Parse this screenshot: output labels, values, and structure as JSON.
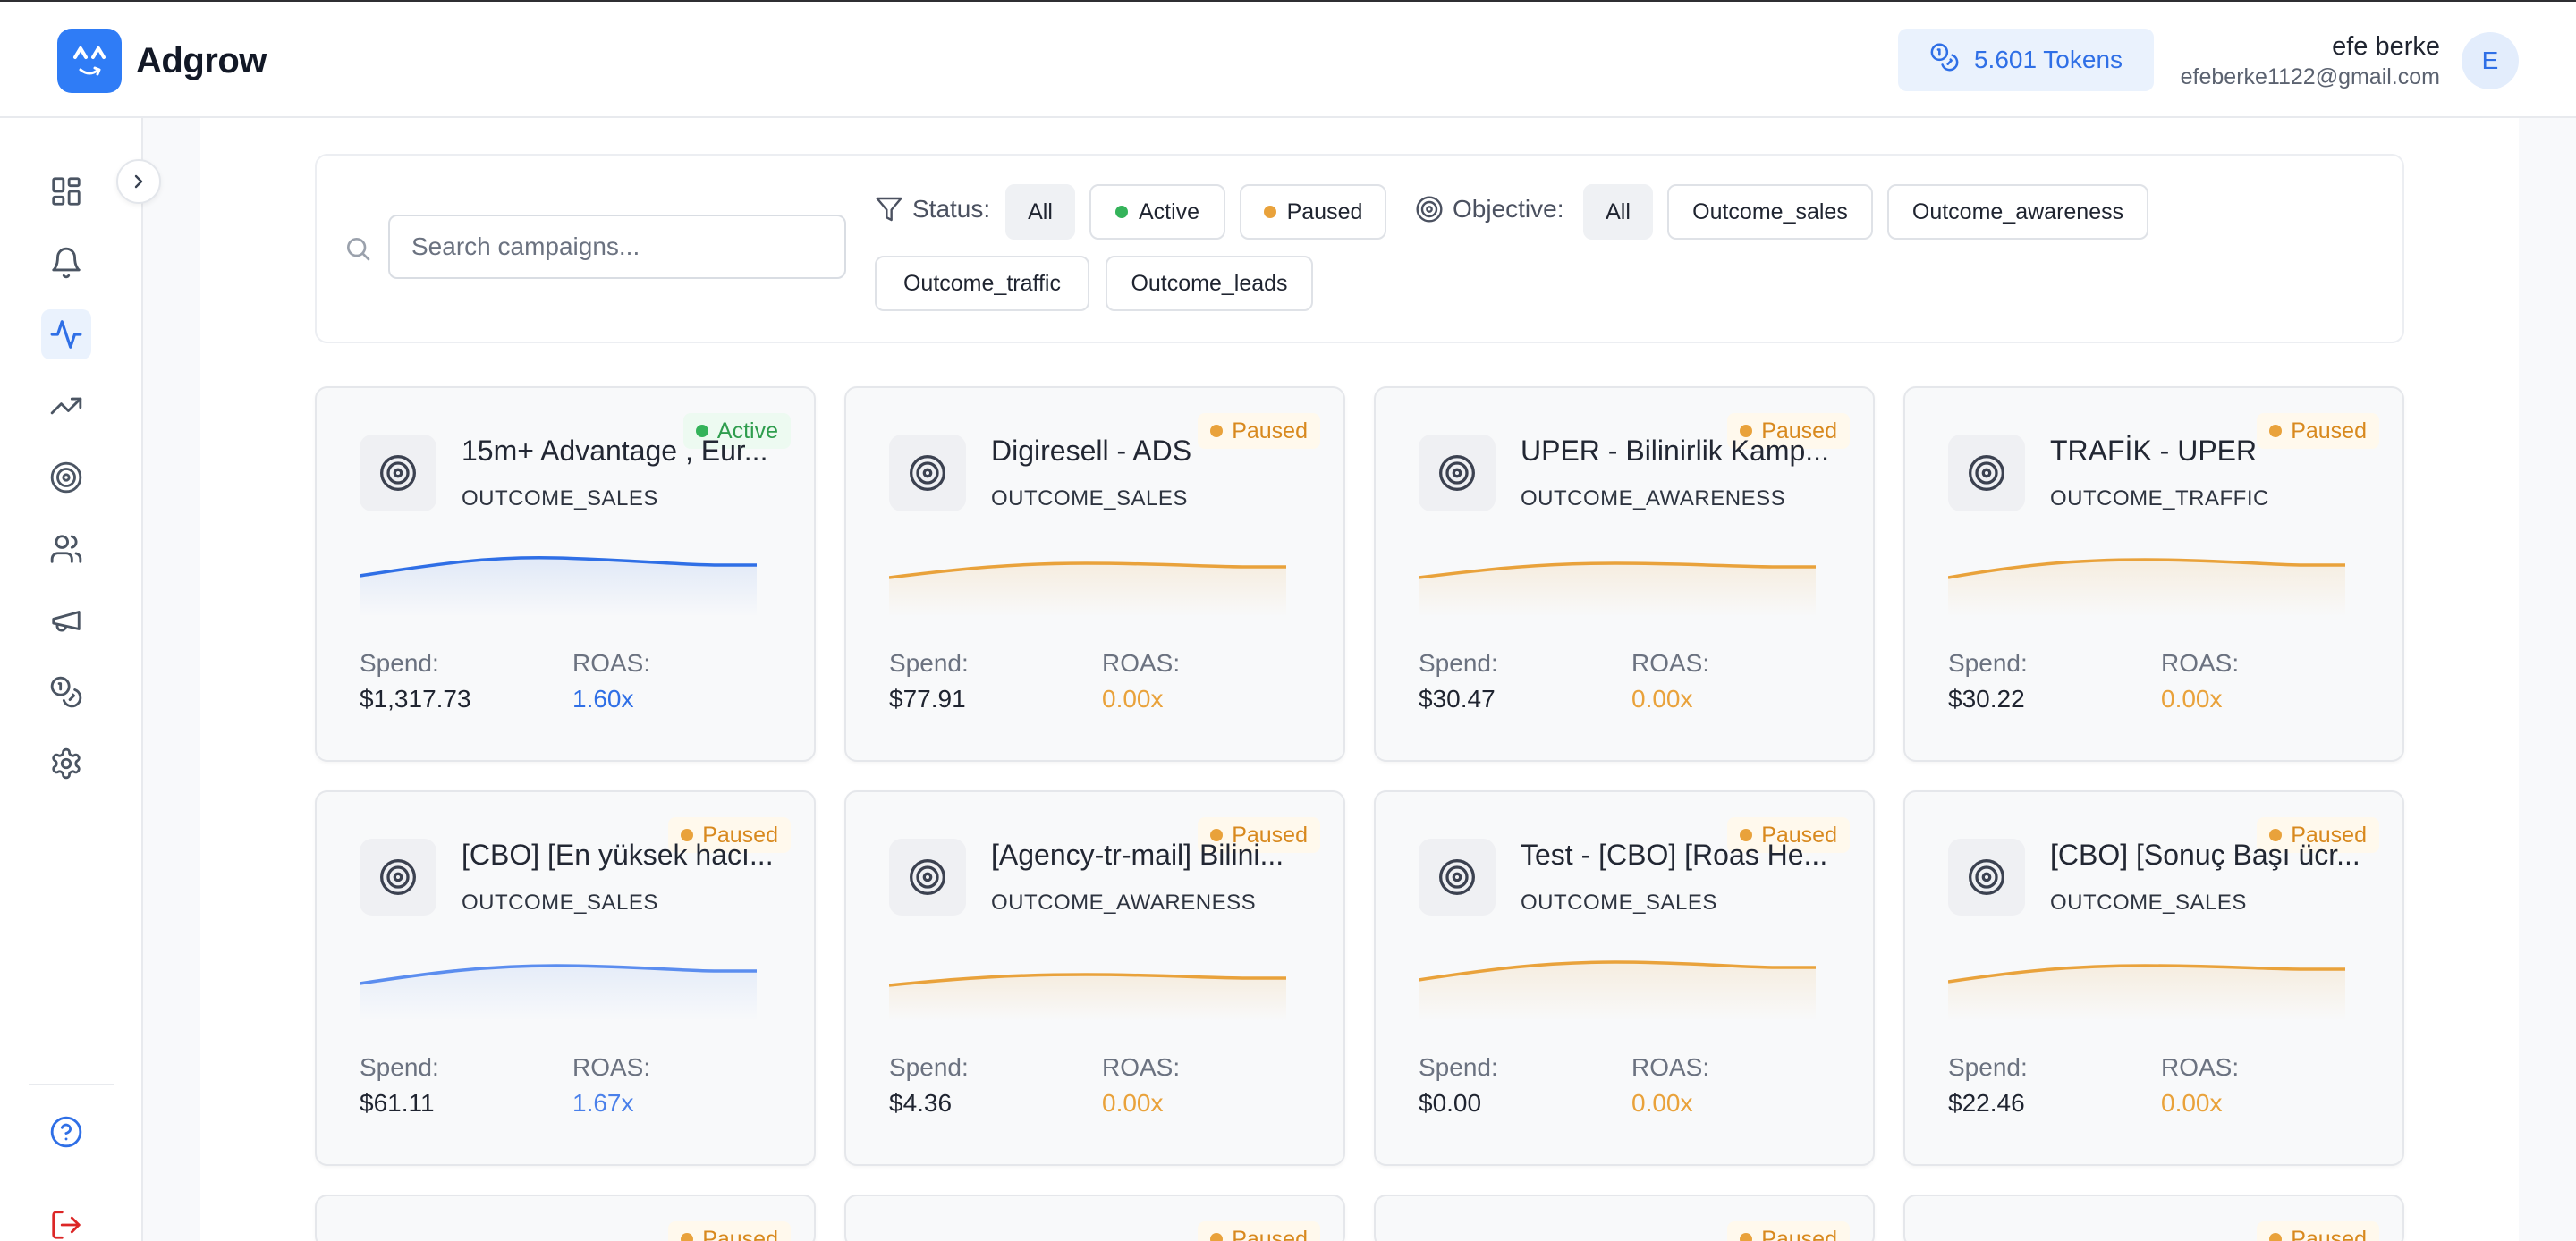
{
  "header": {
    "app_name": "Adgrow",
    "tokens": "5.601 Tokens",
    "user_name": "efe berke",
    "user_email": "efeberke1122@gmail.com",
    "avatar_initial": "E"
  },
  "sidebar": {
    "items": [
      {
        "icon": "dashboard-icon",
        "active": false
      },
      {
        "icon": "bell-icon",
        "active": false
      },
      {
        "icon": "activity-icon",
        "active": true
      },
      {
        "icon": "trending-up-icon",
        "active": false
      },
      {
        "icon": "target-icon",
        "active": false
      },
      {
        "icon": "users-icon",
        "active": false
      },
      {
        "icon": "megaphone-icon",
        "active": false
      },
      {
        "icon": "coins-icon",
        "active": false
      },
      {
        "icon": "gear-icon",
        "active": false
      }
    ],
    "bottom": [
      {
        "icon": "help-circle-icon"
      },
      {
        "icon": "logout-icon"
      }
    ]
  },
  "filters": {
    "search_placeholder": "Search campaigns...",
    "status_label": "Status:",
    "status_options": [
      "All",
      "Active",
      "Paused"
    ],
    "objective_label": "Objective:",
    "objective_options": [
      "All",
      "Outcome_sales",
      "Outcome_awareness",
      "Outcome_traffic",
      "Outcome_leads"
    ]
  },
  "card_labels": {
    "spend": "Spend:",
    "roas": "ROAS:"
  },
  "campaigns": [
    {
      "name": "15m+ Advantage , Eur...",
      "objective": "OUTCOME_SALES",
      "status": "Active",
      "spend": "$1,317.73",
      "roas": "1.60x"
    },
    {
      "name": "Digiresell - ADS",
      "objective": "OUTCOME_SALES",
      "status": "Paused",
      "spend": "$77.91",
      "roas": "0.00x"
    },
    {
      "name": "UPER - Bilinirlik Kamp...",
      "objective": "OUTCOME_AWARENESS",
      "status": "Paused",
      "spend": "$30.47",
      "roas": "0.00x"
    },
    {
      "name": "TRAFİK - UPER",
      "objective": "OUTCOME_TRAFFIC",
      "status": "Paused",
      "spend": "$30.22",
      "roas": "0.00x"
    },
    {
      "name": "[CBO] [En yüksek hacı...",
      "objective": "OUTCOME_SALES",
      "status": "Paused",
      "spend": "$61.11",
      "roas": "1.67x"
    },
    {
      "name": "[Agency-tr-mail] Bilini...",
      "objective": "OUTCOME_AWARENESS",
      "status": "Paused",
      "spend": "$4.36",
      "roas": "0.00x"
    },
    {
      "name": "Test - [CBO] [Roas He...",
      "objective": "OUTCOME_SALES",
      "status": "Paused",
      "spend": "$0.00",
      "roas": "0.00x"
    },
    {
      "name": "[CBO] [Sonuç Başı ücr...",
      "objective": "OUTCOME_SALES",
      "status": "Paused",
      "spend": "$22.46",
      "roas": "0.00x"
    },
    {
      "status": "Paused"
    },
    {
      "status": "Paused"
    },
    {
      "status": "Paused"
    },
    {
      "status": "Paused"
    }
  ],
  "colors": {
    "accent_blue": "#2f6fe6",
    "active_green": "#34b35a",
    "paused_orange": "#e9a23b",
    "roas_blue": "#2f6fe6",
    "roas_orange": "#e9a23b"
  }
}
